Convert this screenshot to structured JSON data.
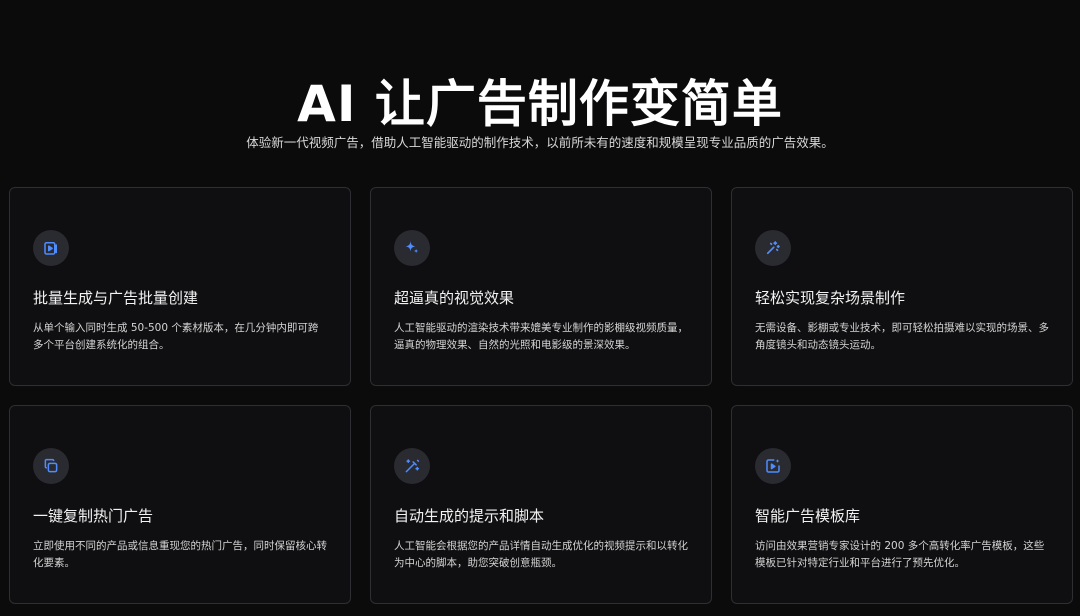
{
  "hero": {
    "title": "AI 让广告制作变简单",
    "subtitle": "体验新一代视频广告，借助人工智能驱动的制作技术，以前所未有的速度和规模呈现专业品质的广告效果。"
  },
  "colors": {
    "background": "#0b0b0c",
    "card_background": "#0f0f11",
    "card_border": "#2e2e33",
    "icon_accent": "#4f8dff",
    "icon_circle": "#2a2b30"
  },
  "features": [
    {
      "icon": "video-play-icon",
      "title": "批量生成与广告批量创建",
      "description": "从单个输入同时生成 50-500 个素材版本，在几分钟内即可跨多个平台创建系统化的组合。"
    },
    {
      "icon": "sparkle-icon",
      "title": "超逼真的视觉效果",
      "description": "人工智能驱动的渲染技术带来媲美专业制作的影棚级视频质量，逼真的物理效果、自然的光照和电影级的景深效果。"
    },
    {
      "icon": "magic-wand-icon",
      "title": "轻松实现复杂场景制作",
      "description": "无需设备、影棚或专业技术，即可轻松拍摄难以实现的场景、多角度镜头和动态镜头运动。"
    },
    {
      "icon": "copy-icon",
      "title": "一键复制热门广告",
      "description": "立即使用不同的产品或信息重现您的热门广告，同时保留核心转化要素。"
    },
    {
      "icon": "wand-sparkle-icon",
      "title": "自动生成的提示和脚本",
      "description": "人工智能会根据您的产品详情自动生成优化的视频提示和以转化为中心的脚本，助您突破创意瓶颈。"
    },
    {
      "icon": "template-video-icon",
      "title": "智能广告模板库",
      "description": "访问由效果营销专家设计的 200 多个高转化率广告模板，这些模板已针对特定行业和平台进行了预先优化。"
    }
  ]
}
